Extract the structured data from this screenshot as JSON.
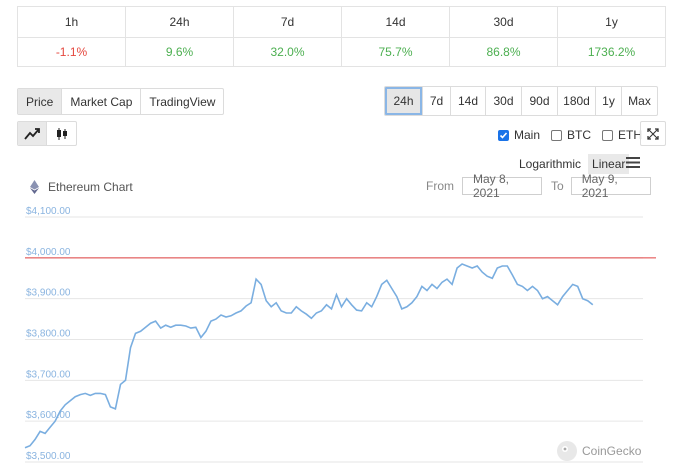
{
  "changes": [
    {
      "period": "1h",
      "value": "-1.1%",
      "color": "#e5483f"
    },
    {
      "period": "24h",
      "value": "9.6%",
      "color": "#4caf50"
    },
    {
      "period": "7d",
      "value": "32.0%",
      "color": "#4caf50"
    },
    {
      "period": "14d",
      "value": "75.7%",
      "color": "#4caf50"
    },
    {
      "period": "30d",
      "value": "86.8%",
      "color": "#4caf50"
    },
    {
      "period": "1y",
      "value": "1736.2%",
      "color": "#4caf50"
    }
  ],
  "view_tabs": [
    "Price",
    "Market Cap",
    "TradingView"
  ],
  "range_tabs": [
    "24h",
    "7d",
    "14d",
    "30d",
    "90d",
    "180d",
    "1y",
    "Max"
  ],
  "icons": {
    "line": "line-chart-icon",
    "candle": "candlestick-icon",
    "expand": "expand-icon",
    "menu": "hamburger-menu-icon",
    "coin": "ethereum-icon",
    "brand": "coingecko-icon"
  },
  "series_toggles": [
    {
      "label": "Main",
      "checked": true
    },
    {
      "label": "BTC",
      "checked": false
    },
    {
      "label": "ETH",
      "checked": false
    }
  ],
  "scale": {
    "log": "Logarithmic",
    "linear": "Linear"
  },
  "chart_title": "Ethereum Chart",
  "date_range": {
    "from_label": "From",
    "from": "May 8, 2021",
    "to_label": "To",
    "to": "May 9, 2021"
  },
  "watermark": "CoinGecko",
  "colors": {
    "line": "#7aaee0",
    "reference": "#e04040",
    "grid": "#e6e6e6",
    "axis_text": "#8ab4e0"
  },
  "chart_data": {
    "type": "line",
    "title": "Ethereum Chart",
    "xlabel": "",
    "ylabel": "",
    "ylim": [
      3500,
      4100
    ],
    "yticks": [
      3500,
      3600,
      3700,
      3800,
      3900,
      4000,
      4100
    ],
    "ytick_labels": [
      "$3,500.00",
      "$3,600.00",
      "$3,700.00",
      "$3,800.00",
      "$3,900.00",
      "$4,000.00",
      "$4,100.00"
    ],
    "reference_line": 4000,
    "grid": true,
    "x_index": [
      0,
      5,
      10,
      15,
      20,
      25,
      30,
      35,
      40,
      45,
      50,
      55,
      60,
      65,
      70,
      75,
      80,
      85,
      90,
      95,
      100,
      105,
      110,
      115,
      120,
      125,
      130,
      135,
      140,
      145,
      150,
      155,
      160,
      165,
      170,
      175,
      180,
      185,
      190,
      195,
      200,
      205,
      210,
      215,
      220,
      225,
      230,
      235,
      240,
      245,
      250,
      255,
      260,
      265,
      270,
      275,
      280,
      285,
      290,
      295,
      300,
      305,
      310,
      315,
      320,
      325,
      330,
      335,
      340,
      345,
      350,
      355,
      360,
      365,
      370,
      375,
      380,
      385,
      390,
      395,
      400,
      405,
      410,
      415,
      420,
      425,
      430,
      435,
      440,
      445,
      450,
      455,
      460,
      465,
      470,
      475,
      480,
      485,
      490,
      495,
      500,
      505,
      510,
      515,
      520,
      525,
      530,
      535,
      540,
      545,
      550,
      555,
      560,
      565,
      570,
      575,
      580,
      585,
      590,
      595,
      600,
      605,
      610,
      615
    ],
    "values": [
      3535,
      3540,
      3555,
      3575,
      3570,
      3585,
      3600,
      3625,
      3640,
      3650,
      3660,
      3665,
      3668,
      3663,
      3668,
      3668,
      3665,
      3635,
      3630,
      3690,
      3700,
      3780,
      3815,
      3820,
      3830,
      3840,
      3845,
      3828,
      3835,
      3830,
      3835,
      3835,
      3833,
      3828,
      3830,
      3805,
      3820,
      3845,
      3850,
      3860,
      3855,
      3858,
      3865,
      3870,
      3882,
      3890,
      3948,
      3935,
      3895,
      3880,
      3890,
      3870,
      3865,
      3865,
      3880,
      3870,
      3862,
      3852,
      3865,
      3870,
      3885,
      3875,
      3910,
      3880,
      3900,
      3885,
      3872,
      3870,
      3890,
      3880,
      3905,
      3935,
      3945,
      3925,
      3905,
      3875,
      3880,
      3890,
      3905,
      3930,
      3920,
      3935,
      3925,
      3940,
      3948,
      3935,
      3975,
      3985,
      3980,
      3975,
      3980,
      3965,
      3955,
      3950,
      3975,
      3980,
      3980,
      3958,
      3935,
      3930,
      3920,
      3930,
      3920,
      3900,
      3905,
      3895,
      3885,
      3905,
      3920,
      3935,
      3930,
      3900,
      3895,
      3885
    ]
  }
}
